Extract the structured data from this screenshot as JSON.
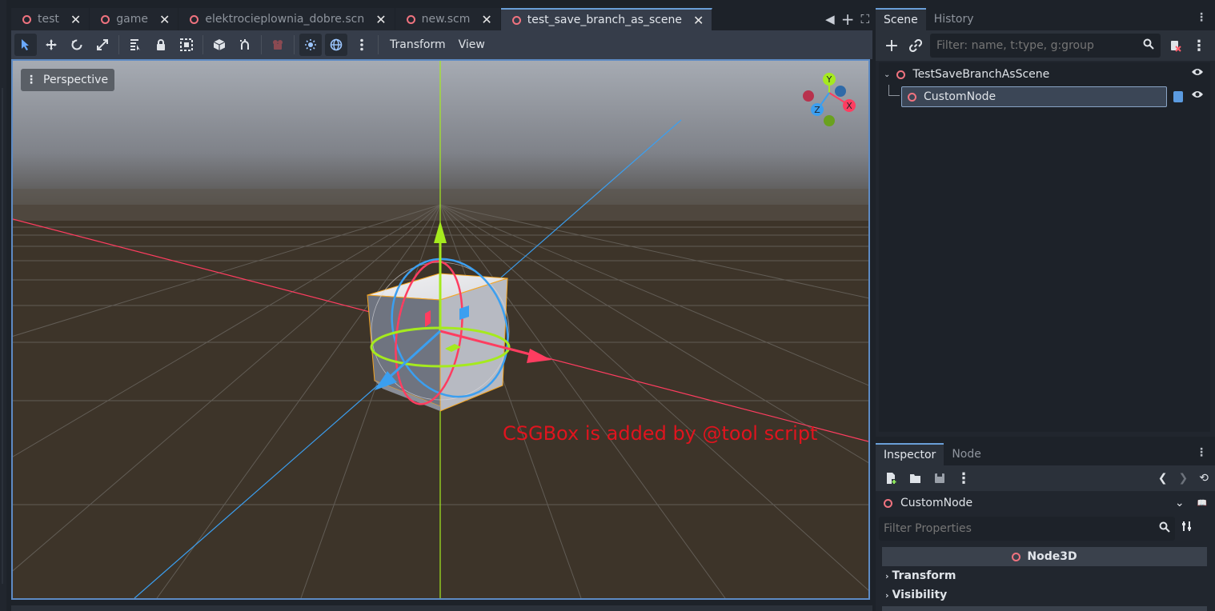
{
  "tabs": [
    {
      "label": "test",
      "active": false
    },
    {
      "label": "game",
      "active": false
    },
    {
      "label": "elektrocieplownia_dobre.scn",
      "active": false
    },
    {
      "label": "new.scm",
      "active": false
    },
    {
      "label": "test_save_branch_as_scene",
      "active": true
    }
  ],
  "toolbar": {
    "menus": {
      "transform": "Transform",
      "view": "View"
    },
    "icons": [
      "select-icon",
      "move-icon",
      "rotate-icon",
      "scale-icon",
      "list-select-icon",
      "lock-icon",
      "group-icon",
      "ruler-icon",
      "snap-icon",
      "camera-icon",
      "sun-icon",
      "environment-icon",
      "more-icon"
    ]
  },
  "viewport": {
    "mode_label": "Perspective",
    "annotation": "CSGBox is added by @tool script",
    "gizmo_axes": {
      "x": "X",
      "y": "Y",
      "z": "Z"
    },
    "colors": {
      "x_axis": "#ff3d60",
      "y_axis": "#a5ea1e",
      "z_axis": "#3b9ff0",
      "selection": "#f5a623",
      "annotation": "#e0141e"
    }
  },
  "scene_dock": {
    "tabs": {
      "scene": "Scene",
      "history": "History"
    },
    "filter_placeholder": "Filter: name, t:type, g:group",
    "tree": {
      "root": "TestSaveBranchAsScene",
      "child": "CustomNode"
    }
  },
  "inspector_dock": {
    "tabs": {
      "inspector": "Inspector",
      "node": "Node"
    },
    "selected_node": "CustomNode",
    "filter_placeholder": "Filter Properties",
    "section": "Node3D",
    "groups": {
      "transform": "Transform",
      "visibility": "Visibility"
    }
  }
}
